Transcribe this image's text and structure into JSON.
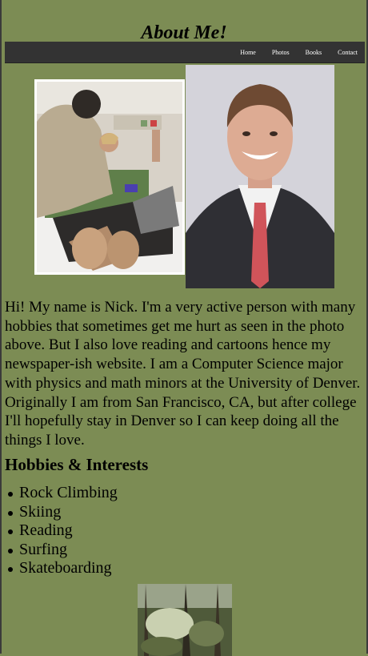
{
  "page": {
    "title": "About Me!"
  },
  "nav": {
    "items": [
      {
        "label": "Home"
      },
      {
        "label": "Photos"
      },
      {
        "label": "Books"
      },
      {
        "label": "Contact"
      }
    ]
  },
  "images": {
    "hospital_photo": {
      "icon": "hospital-photo"
    },
    "portrait_photo": {
      "icon": "portrait-photo"
    },
    "forest_photo": {
      "icon": "forest-photo"
    }
  },
  "intro": {
    "text": "Hi! My name is Nick. I'm a very active person with many hobbies that sometimes get me hurt as seen in the photo above. But I also love reading and cartoons hence my newspaper-ish website. I am a Computer Science major with physics and math minors at the University of Denver. Originally I am from San Francisco, CA, but after college I'll hopefully stay in Denver so I can keep doing all the things I love."
  },
  "hobbies": {
    "heading": "Hobbies & Interests",
    "items": [
      "Rock Climbing",
      "Skiing",
      "Reading",
      "Surfing",
      "Skateboarding"
    ]
  },
  "colors": {
    "background": "#7c8c54",
    "nav_bar": "#333333",
    "nav_text": "#ffffff"
  }
}
